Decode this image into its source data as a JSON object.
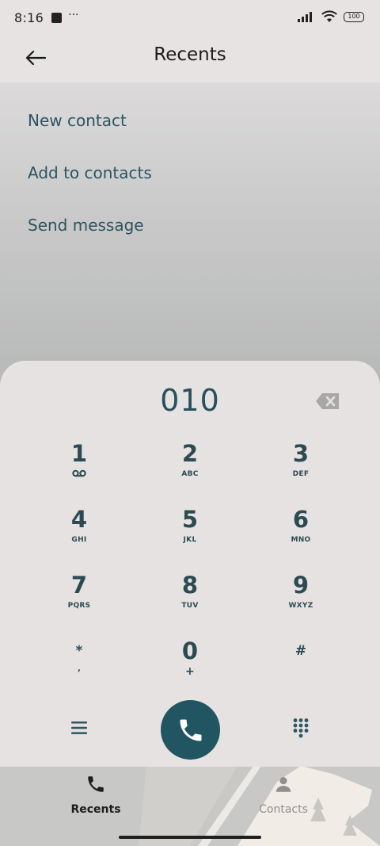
{
  "status_bar": {
    "time": "8:16",
    "dots": "···",
    "battery": "100"
  },
  "header": {
    "title": "Recents"
  },
  "menu": {
    "items": [
      {
        "label": "New contact"
      },
      {
        "label": "Add to contacts"
      },
      {
        "label": "Send message"
      }
    ]
  },
  "dialpad": {
    "number": "010",
    "keys": [
      {
        "digit": "1",
        "letters": ""
      },
      {
        "digit": "2",
        "letters": "ABC"
      },
      {
        "digit": "3",
        "letters": "DEF"
      },
      {
        "digit": "4",
        "letters": "GHI"
      },
      {
        "digit": "5",
        "letters": "JKL"
      },
      {
        "digit": "6",
        "letters": "MNO"
      },
      {
        "digit": "7",
        "letters": "PQRS"
      },
      {
        "digit": "8",
        "letters": "TUV"
      },
      {
        "digit": "9",
        "letters": "WXYZ"
      },
      {
        "digit": "*",
        "letters": ","
      },
      {
        "digit": "0",
        "letters": "+"
      },
      {
        "digit": "#",
        "letters": ""
      }
    ]
  },
  "bottom_nav": {
    "tabs": [
      {
        "label": "Recents",
        "icon": "phone-icon",
        "active": true
      },
      {
        "label": "Contacts",
        "icon": "person-icon",
        "active": false
      }
    ]
  },
  "colors": {
    "accent": "#225562",
    "text_primary": "#27505c",
    "background": "#e6e3e2"
  }
}
